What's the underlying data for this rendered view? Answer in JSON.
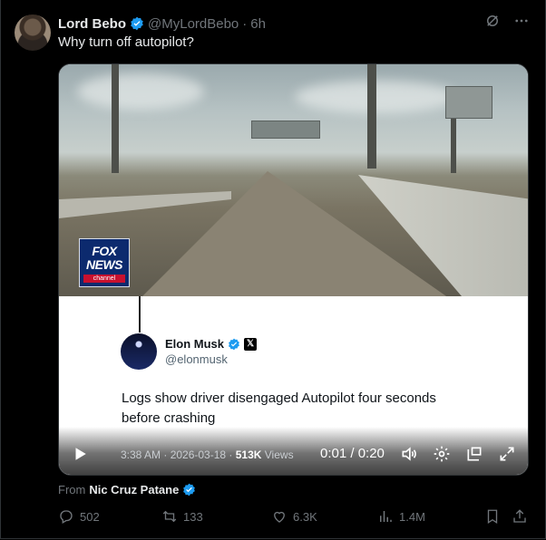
{
  "tweet": {
    "author_name": "Lord Bebo",
    "handle": "@MyLordBebo",
    "separator": "·",
    "time": "6h",
    "text": "Why turn off autopilot?"
  },
  "media": {
    "fox": {
      "line1": "FOX",
      "line2": "NEWS",
      "line3": "channel"
    },
    "quoted": {
      "name": "Elon Musk",
      "handle": "@elonmusk",
      "text": "Logs show driver disengaged Autopilot four seconds before crashing"
    },
    "video": {
      "progress": 0.05,
      "meta_time": "3:38 AM · 2026-03-18 · ",
      "meta_views_count": "513K",
      "meta_views_label": " Views",
      "timecode": "0:01 / 0:20"
    }
  },
  "from": {
    "label": "From",
    "source": "Nic Cruz Patane"
  },
  "actions": {
    "replies": "502",
    "reposts": "133",
    "likes": "6.3K",
    "views": "1.4M"
  },
  "colors": {
    "verified": "#1d9bf0",
    "text": "#e7e9ea",
    "muted": "#71767b",
    "background": "#000000"
  }
}
